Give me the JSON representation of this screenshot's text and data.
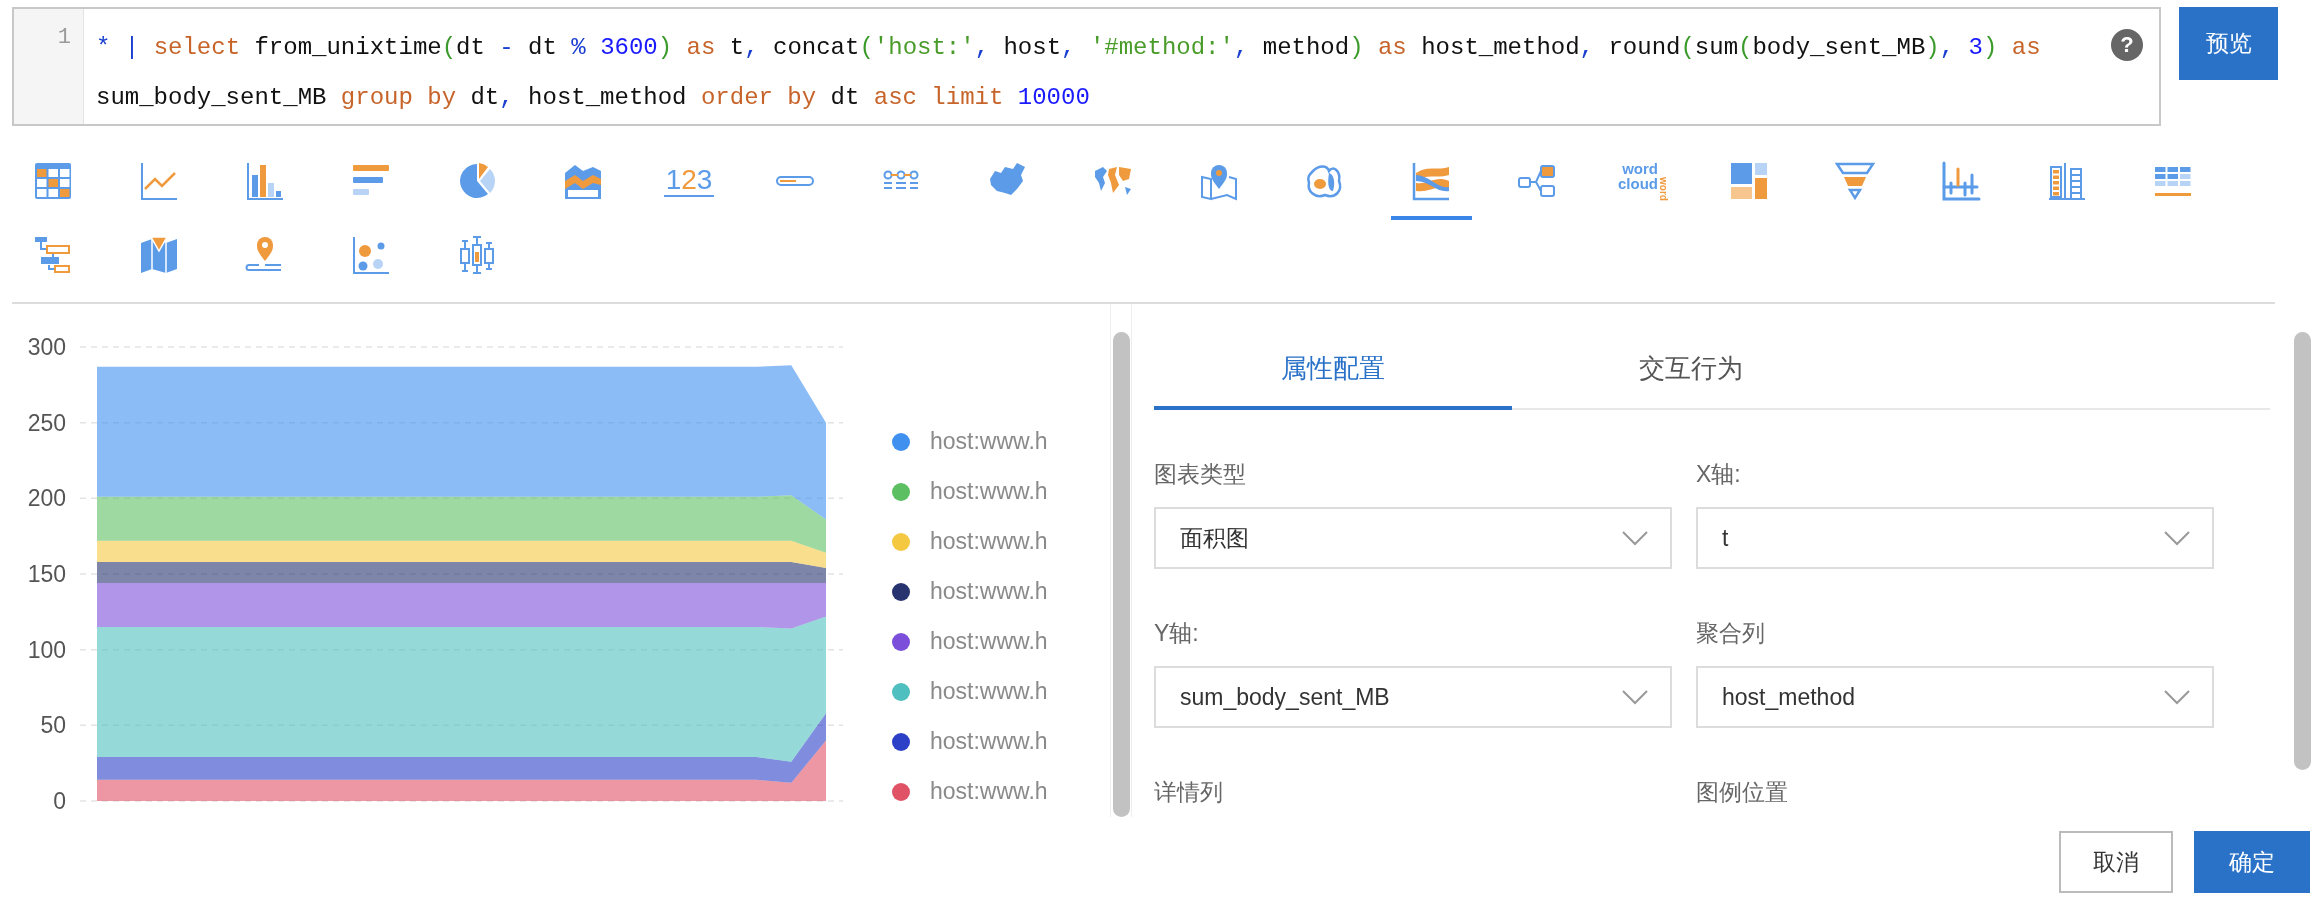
{
  "query_editor": {
    "line_number": "1",
    "help": "?",
    "lines": [
      {
        "segments": [
          {
            "kind": "op",
            "text": "* "
          },
          {
            "kind": "op",
            "text": "| "
          },
          {
            "kind": "kw",
            "text": "select"
          },
          {
            "kind": "plain",
            "text": " from_unixtime"
          },
          {
            "kind": "paren",
            "text": "("
          },
          {
            "kind": "plain",
            "text": "dt "
          },
          {
            "kind": "op",
            "text": "-"
          },
          {
            "kind": "plain",
            "text": " dt "
          },
          {
            "kind": "op",
            "text": "% "
          },
          {
            "kind": "num",
            "text": "3600"
          },
          {
            "kind": "paren",
            "text": ")"
          },
          {
            "kind": "kw",
            "text": " as"
          },
          {
            "kind": "plain",
            "text": " t"
          },
          {
            "kind": "op",
            "text": ","
          },
          {
            "kind": "plain",
            "text": " concat"
          },
          {
            "kind": "paren",
            "text": "("
          },
          {
            "kind": "str",
            "text": "'host:'"
          },
          {
            "kind": "op",
            "text": ","
          },
          {
            "kind": "plain",
            "text": " host"
          },
          {
            "kind": "op",
            "text": ", "
          },
          {
            "kind": "str",
            "text": "'#method:'"
          },
          {
            "kind": "op",
            "text": ","
          },
          {
            "kind": "plain",
            "text": " method"
          },
          {
            "kind": "paren",
            "text": ")"
          },
          {
            "kind": "kw",
            "text": " as"
          },
          {
            "kind": "plain",
            "text": " host_method"
          },
          {
            "kind": "op",
            "text": ","
          },
          {
            "kind": "plain",
            "text": " round"
          },
          {
            "kind": "paren",
            "text": "("
          },
          {
            "kind": "plain",
            "text": "sum"
          },
          {
            "kind": "paren",
            "text": "("
          },
          {
            "kind": "plain",
            "text": "body_sent_MB"
          },
          {
            "kind": "paren",
            "text": ")"
          },
          {
            "kind": "op",
            "text": ", "
          },
          {
            "kind": "num",
            "text": "3"
          },
          {
            "kind": "paren",
            "text": ")"
          },
          {
            "kind": "kw",
            "text": " as"
          }
        ]
      },
      {
        "segments": [
          {
            "kind": "plain",
            "text": "sum_body_sent_MB "
          },
          {
            "kind": "kw",
            "text": "group by"
          },
          {
            "kind": "plain",
            "text": " dt"
          },
          {
            "kind": "op",
            "text": ","
          },
          {
            "kind": "plain",
            "text": " host_method "
          },
          {
            "kind": "kw",
            "text": "order by"
          },
          {
            "kind": "plain",
            "text": " dt "
          },
          {
            "kind": "kw",
            "text": "asc "
          },
          {
            "kind": "kw",
            "text": "limit "
          },
          {
            "kind": "num",
            "text": "10000"
          }
        ]
      }
    ]
  },
  "preview_button": "预览",
  "chart_types": [
    {
      "kind": "table",
      "selected": false
    },
    {
      "kind": "line",
      "selected": false
    },
    {
      "kind": "bar",
      "selected": false
    },
    {
      "kind": "bar_h",
      "selected": false
    },
    {
      "kind": "pie",
      "selected": false
    },
    {
      "kind": "area",
      "selected": false
    },
    {
      "kind": "number",
      "selected": false,
      "text": "123"
    },
    {
      "kind": "progress",
      "selected": false
    },
    {
      "kind": "flow",
      "selected": false
    },
    {
      "kind": "map_china",
      "selected": false
    },
    {
      "kind": "map_world",
      "selected": false
    },
    {
      "kind": "map_pin",
      "selected": false
    },
    {
      "kind": "heat",
      "selected": false
    },
    {
      "kind": "river",
      "selected": true
    },
    {
      "kind": "tree",
      "selected": false
    },
    {
      "kind": "word_cloud",
      "selected": false,
      "text": [
        "word",
        "cloud",
        "word"
      ]
    },
    {
      "kind": "treemap",
      "selected": false
    },
    {
      "kind": "funnel",
      "selected": false
    },
    {
      "kind": "column_dots",
      "selected": false
    },
    {
      "kind": "column_stack",
      "selected": false
    },
    {
      "kind": "table_list",
      "selected": false
    },
    {
      "kind": "gantt",
      "selected": false
    },
    {
      "kind": "map_funnel",
      "selected": false
    },
    {
      "kind": "pin_line",
      "selected": false
    },
    {
      "kind": "scatter",
      "selected": false
    },
    {
      "kind": "boxplot",
      "selected": false
    }
  ],
  "chart": {
    "chart_data": {
      "type": "area",
      "stacked": true,
      "grid": true,
      "yticks": [
        0,
        50,
        100,
        150,
        200,
        250,
        300
      ],
      "ylim": [
        0,
        300
      ],
      "series": [
        {
          "name": "host:www.h",
          "color": "#4090f0",
          "values": [
            86,
            86,
            86,
            86,
            86,
            86,
            86,
            86,
            86,
            86,
            86,
            86,
            86,
            86,
            86,
            86,
            86,
            86,
            86,
            86,
            86,
            64
          ]
        },
        {
          "name": "host:www.h",
          "color": "#5cbf62",
          "values": [
            29,
            29,
            29,
            29,
            29,
            29,
            29,
            29,
            29,
            29,
            29,
            29,
            29,
            29,
            29,
            29,
            29,
            29,
            29,
            29,
            30,
            22
          ]
        },
        {
          "name": "host:www.h",
          "color": "#f5c842",
          "values": [
            14,
            14,
            14,
            14,
            14,
            14,
            14,
            14,
            14,
            14,
            14,
            14,
            14,
            14,
            14,
            14,
            14,
            14,
            14,
            14,
            14,
            10
          ]
        },
        {
          "name": "host:www.h",
          "color": "#27336e",
          "values": [
            14,
            14,
            14,
            14,
            14,
            14,
            14,
            14,
            14,
            14,
            14,
            14,
            14,
            14,
            14,
            14,
            14,
            14,
            14,
            14,
            14,
            10
          ]
        },
        {
          "name": "host:www.h",
          "color": "#7b4fd9",
          "values": [
            29,
            29,
            29,
            29,
            29,
            29,
            29,
            29,
            29,
            29,
            29,
            29,
            29,
            29,
            29,
            29,
            29,
            29,
            29,
            29,
            30,
            22
          ]
        },
        {
          "name": "host:www.h",
          "color": "#50bfbf",
          "values": [
            86,
            86,
            86,
            86,
            86,
            86,
            86,
            86,
            86,
            86,
            86,
            86,
            86,
            86,
            86,
            86,
            86,
            86,
            86,
            86,
            88,
            64
          ]
        },
        {
          "name": "host:www.h",
          "color": "#2b3fc7",
          "values": [
            15,
            15,
            15,
            15,
            15,
            15,
            15,
            15,
            15,
            15,
            15,
            15,
            15,
            15,
            15,
            15,
            15,
            15,
            15,
            15,
            14,
            18
          ]
        },
        {
          "name": "host:www.h",
          "color": "#e05266",
          "values": [
            14,
            14,
            14,
            14,
            14,
            14,
            14,
            14,
            14,
            14,
            14,
            14,
            14,
            14,
            14,
            14,
            14,
            14,
            14,
            14,
            12,
            40
          ]
        }
      ]
    }
  },
  "settings": {
    "tabs": [
      {
        "label": "属性配置",
        "selected": true
      },
      {
        "label": "交互行为",
        "selected": false
      }
    ],
    "fields": [
      {
        "label": "图表类型",
        "value": "面积图"
      },
      {
        "label": "X轴:",
        "value": "t"
      },
      {
        "label": "Y轴:",
        "value": "sum_body_sent_MB"
      },
      {
        "label": "聚合列",
        "value": "host_method"
      },
      {
        "label": "详情列"
      },
      {
        "label": "图例位置"
      }
    ]
  },
  "buttons": [
    {
      "label": "取消",
      "kind": "secondary"
    },
    {
      "label": "确定",
      "kind": "primary"
    }
  ]
}
